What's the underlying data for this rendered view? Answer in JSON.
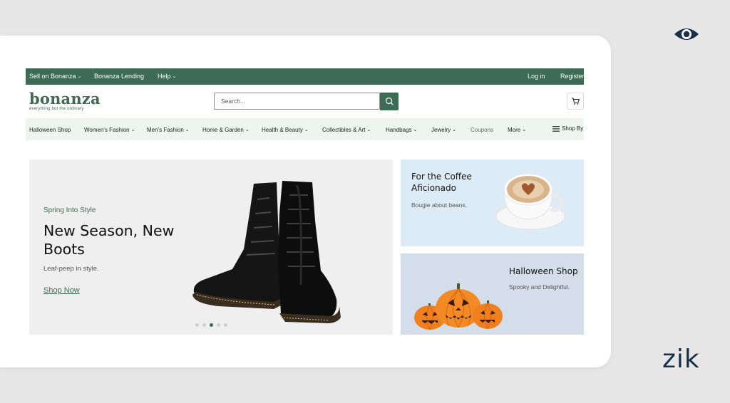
{
  "topbar": {
    "sell": "Sell on Bonanza",
    "lending": "Bonanza Lending",
    "help": "Help",
    "login": "Log in",
    "register": "Register"
  },
  "logo": {
    "name": "bonanza",
    "tagline": "everything but the ordinary"
  },
  "search": {
    "placeholder": "Search..."
  },
  "categories": [
    "Halloween Shop",
    "Women's Fashion",
    "Men's Fashion",
    "Home & Garden",
    "Health & Beauty",
    "Collectibles & Art",
    "Handbags",
    "Jewelry",
    "Coupons",
    "More",
    "Shop By"
  ],
  "hero": {
    "eyebrow": "Spring Into Style",
    "title": "New Season, New Boots",
    "subtitle": "Leaf-peep in style.",
    "link": "Shop Now",
    "carousel": {
      "count": 5,
      "active": 3
    }
  },
  "promo_coffee": {
    "title": "For the Coffee Aficionado",
    "subtitle": "Bougie about beans."
  },
  "promo_halloween": {
    "title": "Halloween Shop",
    "subtitle": "Spooky and Delightful."
  },
  "overlay": {
    "brand": "zik",
    "icon": "eye-icon"
  },
  "colors": {
    "brand_green": "#3e6b53",
    "nav_bg": "#eef5f1",
    "hero_bg": "#efefef",
    "coffee_bg": "#dcebf5",
    "halloween_bg": "#d4deeb",
    "pumpkin": "#f07f1e",
    "overlay_navy": "#183148"
  }
}
